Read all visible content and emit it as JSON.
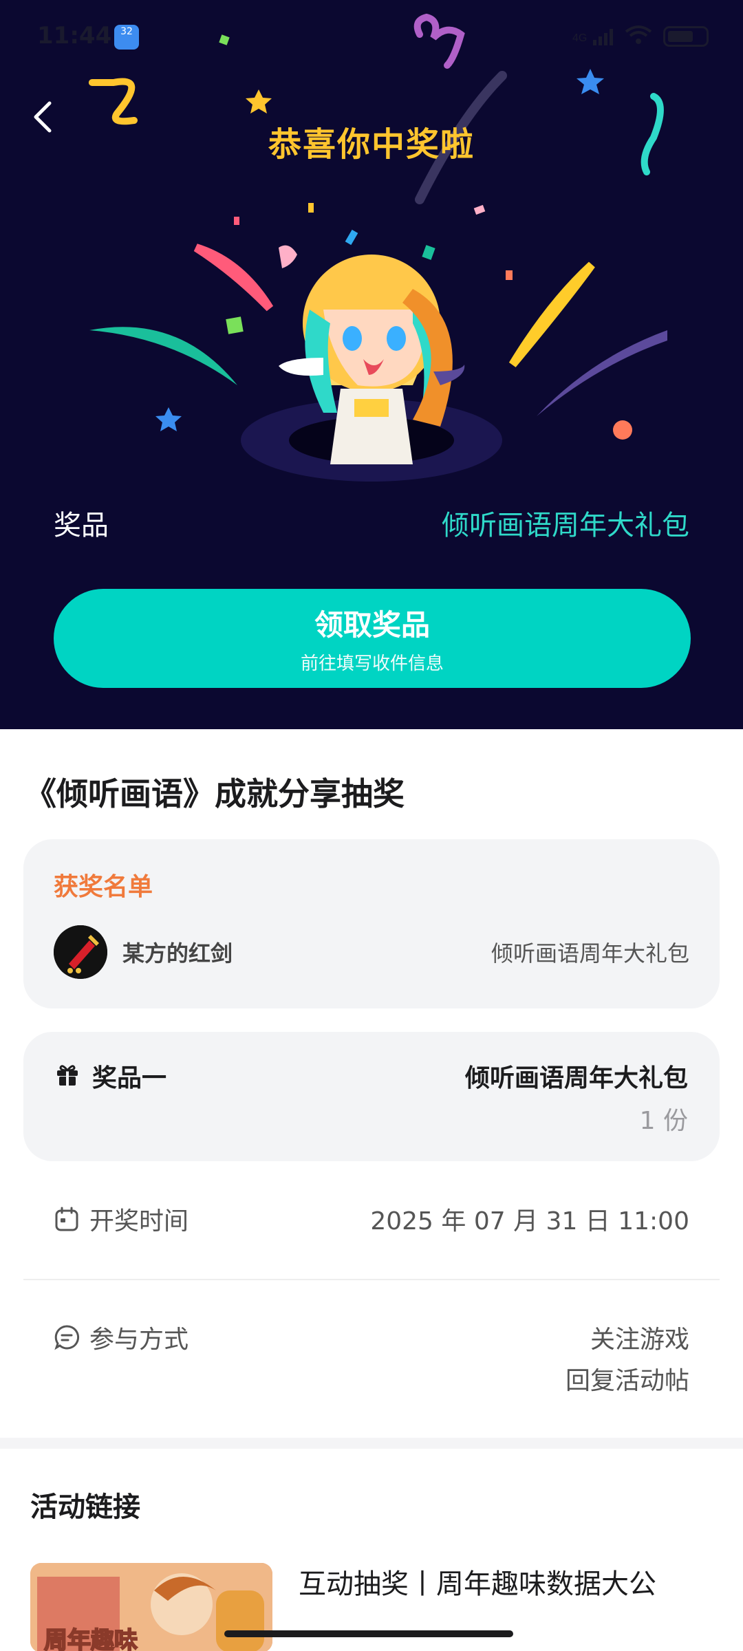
{
  "status_bar": {
    "time": "11:44",
    "badge": "32",
    "signal_text": "4G",
    "battery": "100"
  },
  "hero": {
    "title": "恭喜你中奖啦",
    "prize_label": "奖品",
    "prize_value": "倾听画语周年大礼包",
    "claim_button": {
      "label": "领取奖品",
      "sublabel": "前往填写收件信息"
    }
  },
  "activity": {
    "title": "《倾听画语》成就分享抽奖",
    "winners": {
      "title": "获奖名单",
      "list": [
        {
          "name": "某方的红剑",
          "prize": "倾听画语周年大礼包"
        }
      ]
    },
    "prize": {
      "label": "奖品一",
      "value": "倾听画语周年大礼包",
      "count": "1 份"
    },
    "draw_time": {
      "label": "开奖时间",
      "value": "2025 年 07 月 31 日 11:00"
    },
    "participation": {
      "label": "参与方式",
      "methods": [
        "关注游戏",
        "回复活动帖"
      ]
    }
  },
  "links": {
    "title": "活动链接",
    "item": {
      "title": "互动抽奖丨周年趣味数据大公",
      "thumb_text": "周年趣味"
    }
  },
  "colors": {
    "hero_bg": "#0b0830",
    "accent": "#00d4c3",
    "title_gold": "#ffc52e",
    "winners_orange": "#f07a3c"
  }
}
